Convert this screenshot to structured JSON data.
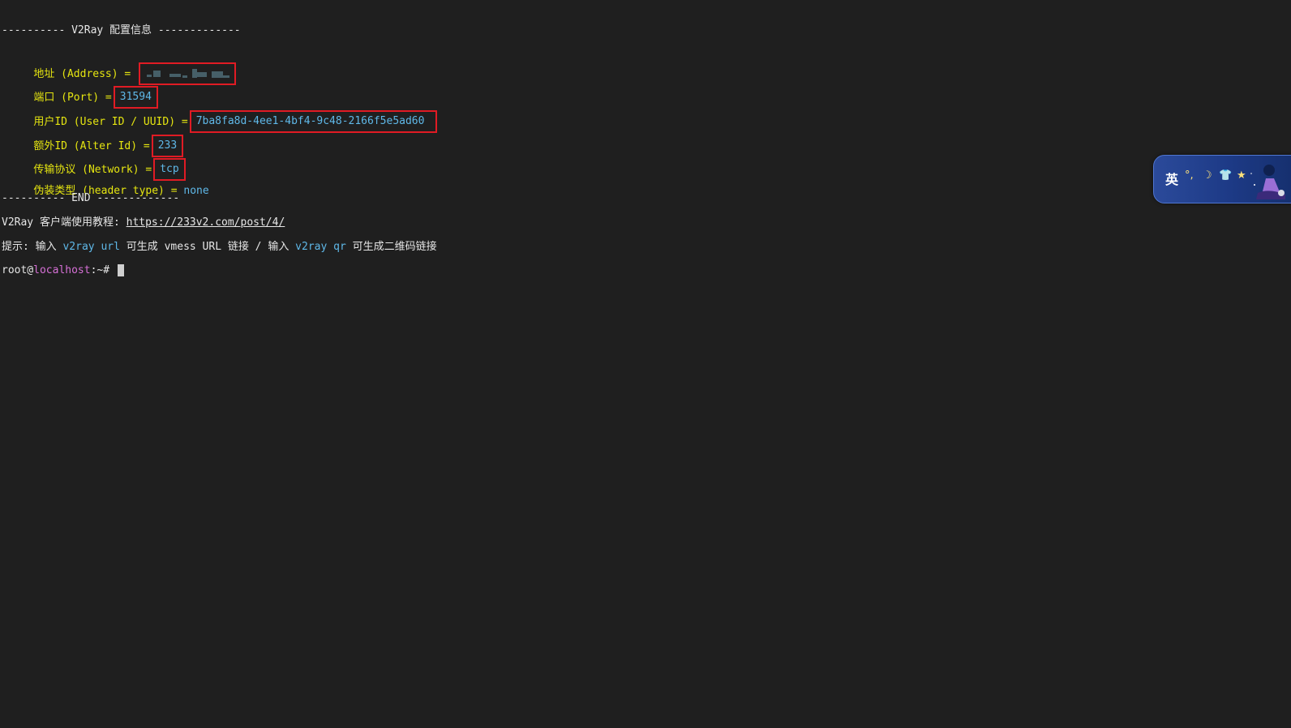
{
  "terminal": {
    "header": "---------- V2Ray 配置信息 -------------",
    "address_label": "地址 (Address) =",
    "port_label": "端口 (Port) =",
    "port_value": "31594",
    "uuid_label": "用户ID (User ID / UUID) =",
    "uuid_value": "7ba8fa8d-4ee1-4bf4-9c48-2166f5e5ad60",
    "alterid_label": "额外ID (Alter Id) =",
    "alterid_value": "233",
    "network_label": "传输协议 (Network) =",
    "network_value": "tcp",
    "header_type_label": "伪装类型 (header type) =",
    "header_type_value": "none",
    "footer": "---------- END -------------",
    "tutorial_label": "V2Ray 客户端使用教程: ",
    "tutorial_link": "https://233v2.com/post/4/",
    "tip_prefix": "提示: 输入 ",
    "tip_cmd1": "v2ray url",
    "tip_mid": " 可生成 vmess URL 链接 / 输入 ",
    "tip_cmd2": "v2ray qr",
    "tip_suffix": " 可生成二维码链接",
    "prompt_user": "root@",
    "prompt_host": "localhost",
    "prompt_path": ":~# "
  },
  "ime": {
    "lang": "英",
    "symbols": [
      "°,",
      "☽",
      "👕",
      "★"
    ]
  },
  "colors": {
    "background": "#1f1f1f",
    "label": "#e5e510",
    "value": "#5fb8e8",
    "host": "#d670d6",
    "highlight_box": "#e01b24"
  }
}
